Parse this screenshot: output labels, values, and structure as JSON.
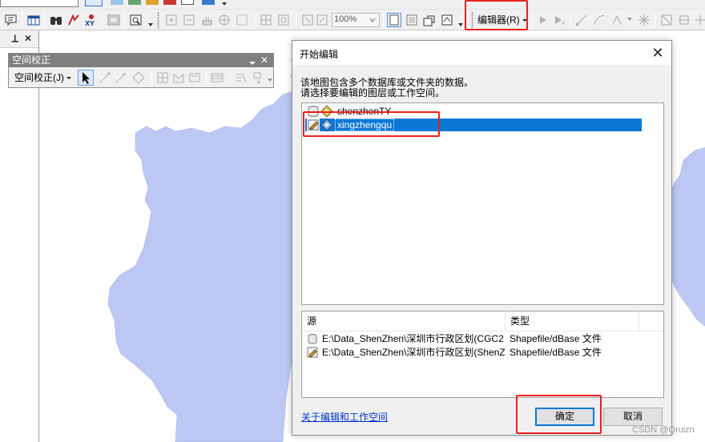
{
  "toolbar_top": {
    "zoom_value": "100%",
    "editor_menu_label": "编辑器(R)"
  },
  "left_pane": {
    "pin_glyph": "⊣",
    "close_glyph": "✕"
  },
  "spatial_toolbar": {
    "title": "空间校正",
    "menu_label": "空间校正(J)",
    "close_glyph": "✕"
  },
  "dialog": {
    "title": "开始编辑",
    "close_glyph": "✕",
    "description_line1": "该地图包含多个数据库或文件夹的数据。",
    "description_line2": "请选择要编辑的图层或工作空间。",
    "layers": [
      {
        "name": "shenzhenTY",
        "icon": "database-cylinder-icon",
        "selected": false
      },
      {
        "name": "xingzhengqu",
        "icon": "edit-pencil-icon",
        "selected": true
      }
    ],
    "source_table": {
      "columns": [
        "源",
        "类型"
      ],
      "rows": [
        {
          "source": "E:\\Data_ShenZhen\\深圳市行政区划(CGC2...",
          "type": "Shapefile/dBase 文件",
          "icon": "database-cylinder-icon"
        },
        {
          "source": "E:\\Data_ShenZhen\\深圳市行政区划(ShenZ...",
          "type": "Shapefile/dBase 文件",
          "icon": "edit-pencil-icon"
        }
      ]
    },
    "help_link": "关于编辑和工作空间",
    "ok_label": "确定",
    "cancel_label": "取消"
  },
  "watermark": "CSDN @Qruizn",
  "colors": {
    "map_land": "#bcc7f4",
    "selection": "#0a78d7",
    "highlight_box": "#e8201c",
    "link": "#0033cc"
  }
}
